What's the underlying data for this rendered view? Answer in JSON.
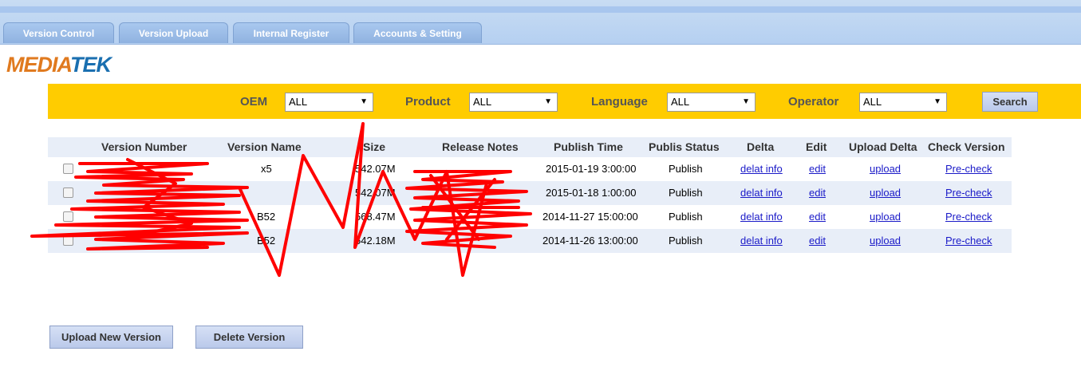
{
  "nav": {
    "tabs": [
      {
        "label": "Version Control"
      },
      {
        "label": "Version Upload"
      },
      {
        "label": "Internal Register"
      },
      {
        "label": "Accounts & Setting"
      }
    ]
  },
  "logo": {
    "part1": "MEDIA",
    "part2": "TEK"
  },
  "filters": {
    "oem": {
      "label": "OEM",
      "value": "ALL"
    },
    "product": {
      "label": "Product",
      "value": "ALL"
    },
    "language": {
      "label": "Language",
      "value": "ALL"
    },
    "operator": {
      "label": "Operator",
      "value": "ALL"
    },
    "search_label": "Search"
  },
  "table": {
    "headers": [
      "Version Number",
      "Version Name",
      "Size",
      "Release Notes",
      "Publish Time",
      "Publis Status",
      "Delta",
      "Edit",
      "Upload Delta",
      "Check Version"
    ],
    "rows": [
      {
        "version_number": "",
        "version_name": "x5",
        "size": "542.07M",
        "release_notes": "",
        "publish_time": "2015-01-19 3:00:00",
        "status": "Publish",
        "delta": "delat info",
        "edit": "edit",
        "upload": "upload",
        "check": "Pre-check"
      },
      {
        "version_number": "",
        "version_name": "",
        "size": "542.07M",
        "release_notes": "",
        "publish_time": "2015-01-18 1:00:00",
        "status": "Publish",
        "delta": "delat info",
        "edit": "edit",
        "upload": "upload",
        "check": "Pre-check"
      },
      {
        "version_number": "",
        "version_name": "B52",
        "size": "568.47M",
        "release_notes": "",
        "publish_time": "2014-11-27 15:00:00",
        "status": "Publish",
        "delta": "delat info",
        "edit": "edit",
        "upload": "upload",
        "check": "Pre-check"
      },
      {
        "version_number": "",
        "version_name": "B52",
        "size": "542.18M",
        "release_notes": "",
        "publish_time": "2014-11-26 13:00:00",
        "status": "Publish",
        "delta": "delat info",
        "edit": "edit",
        "upload": "upload",
        "check": "Pre-check"
      }
    ]
  },
  "actions": {
    "upload_new": "Upload New Version",
    "delete": "Delete Version"
  },
  "colors": {
    "filter_bar": "#ffcc00",
    "header_bg": "#b5d0f1",
    "scribble": "#ff0000"
  }
}
